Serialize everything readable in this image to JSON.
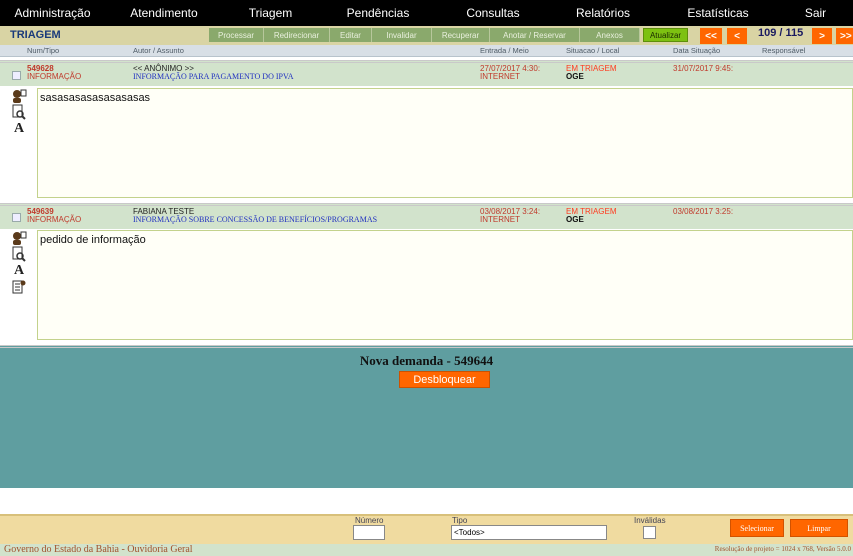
{
  "menu": [
    "Administração",
    "Atendimento",
    "Triagem",
    "Pendências",
    "Consultas",
    "Relatórios",
    "Estatísticas",
    "Sair"
  ],
  "toolbar": {
    "title": "TRIAGEM",
    "buttons": [
      "Processar",
      "Redirecionar",
      "Editar",
      "Invalidar",
      "Recuperar",
      "Anotar / Reservar",
      "Anexos"
    ],
    "refresh": "Atualizar",
    "first": "<<",
    "prev": "<",
    "counter": "109 / 115",
    "next": ">",
    "last": ">>"
  },
  "columns": {
    "num_tipo": "Num/Tipo",
    "autor_assunto": "Autor / Assunto",
    "entrada_meio": "Entrada / Meio",
    "situacao_local": "Situacao / Local",
    "data_situacao": "Data Situação",
    "responsavel": "Responsável"
  },
  "records": [
    {
      "num": "549628",
      "tipo": "INFORMAÇÃO",
      "autor": "<< ANÔNIMO >>",
      "assunto": "INFORMAÇÃO PARA PAGAMENTO DO IPVA",
      "entrada": "27/07/2017 4:30:",
      "meio": "INTERNET",
      "situacao": "EM TRIAGEM",
      "local": "OGE",
      "data_situacao": "31/07/2017 9:45:",
      "texto": "sasasasasasasasasas"
    },
    {
      "num": "549639",
      "tipo": "INFORMAÇÃO",
      "autor": "FABIANA TESTE",
      "assunto": "INFORMAÇÃO SOBRE CONCESSÃO DE BENEFÍCIOS/PROGRAMAS",
      "entrada": "03/08/2017 3:24:",
      "meio": "INTERNET",
      "situacao": "EM TRIAGEM",
      "local": "OGE",
      "data_situacao": "03/08/2017 3:25:",
      "texto": "pedido de informação"
    }
  ],
  "new_demand": {
    "title": "Nova demanda - 549644",
    "unlock": "Desbloquear"
  },
  "filters": {
    "numero_label": "Número",
    "numero_value": "",
    "tipo_label": "Tipo",
    "tipo_value": "<Todos>",
    "invalidas_label": "Inválidas",
    "select": "Selecionar",
    "clear": "Limpar"
  },
  "footer": {
    "left": "Governo do Estado da Bahia - Ouvidoria Geral",
    "right": "Resolução de projeto = 1024 x 768, Versão 5.0.0"
  },
  "colors": {
    "menu_bg": "#000000",
    "toolbar_bg": "#d9d4a4",
    "accent_orange": "#ff6600",
    "record_header_bg": "#d2e3cc",
    "panel_teal": "#5f9ea0"
  }
}
